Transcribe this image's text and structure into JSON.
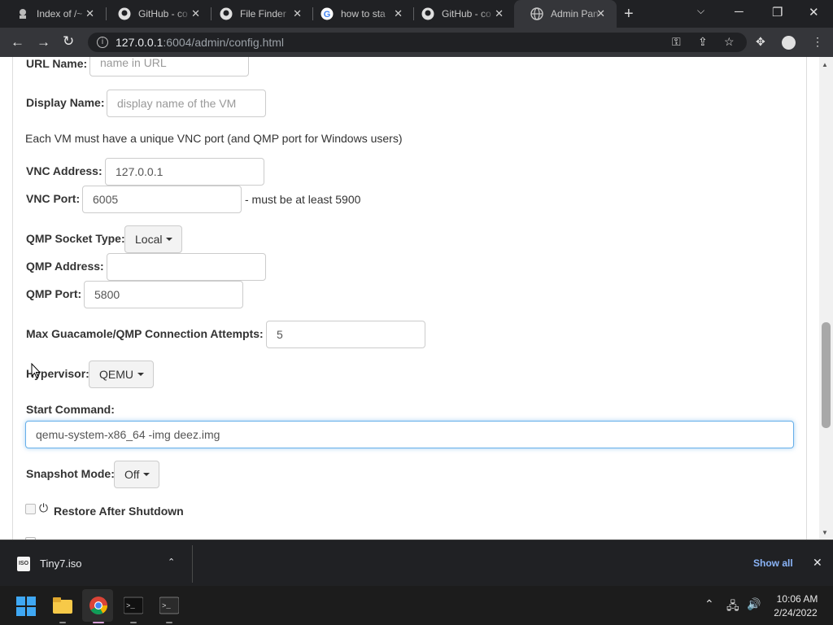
{
  "browser": {
    "tabs": [
      {
        "title": "Index of /~",
        "icon": "web-icon"
      },
      {
        "title": "GitHub - co",
        "icon": "github-icon"
      },
      {
        "title": "File Finder",
        "icon": "github-icon"
      },
      {
        "title": "how to sta",
        "icon": "google-icon"
      },
      {
        "title": "GitHub - co",
        "icon": "github-icon"
      },
      {
        "title": "Admin Pan",
        "icon": "globe-icon",
        "active": true
      }
    ],
    "url_host": "127.0.0.1",
    "url_rest": ":6004/admin/config.html"
  },
  "form": {
    "url_name_label": "URL Name:",
    "url_name_placeholder": "name in URL",
    "display_name_label": "Display Name:",
    "display_name_placeholder": "display name of the VM",
    "vnc_note": "Each VM must have a unique VNC port (and QMP port for Windows users)",
    "vnc_address_label": "VNC Address:",
    "vnc_address_value": "127.0.0.1",
    "vnc_port_label": "VNC Port:",
    "vnc_port_value": "6005",
    "vnc_port_hint": "- must be at least 5900",
    "qmp_socket_label": "QMP Socket Type:",
    "qmp_socket_value": "Local",
    "qmp_address_label": "QMP Address:",
    "qmp_address_value": "",
    "qmp_port_label": "QMP Port:",
    "qmp_port_value": "5800",
    "max_attempts_label": "Max Guacamole/QMP Connection Attempts:",
    "max_attempts_value": "5",
    "hypervisor_label": "Hypervisor:",
    "hypervisor_value": "QEMU",
    "start_command_label": "Start Command:",
    "start_command_value": "qemu-system-x86_64 -img deez.img",
    "snapshot_label": "Snapshot Mode:",
    "snapshot_value": "Off",
    "restore_label": "Restore After Shutdown"
  },
  "downloads": {
    "file_name": "Tiny7.iso",
    "show_all": "Show all"
  },
  "taskbar": {
    "time": "10:06 AM",
    "date": "2/24/2022"
  },
  "colors": {
    "accent": "#66afe9",
    "chrome_dark": "#202124",
    "chrome_toolbar": "#35363a",
    "link_blue": "#8ab4f8"
  }
}
